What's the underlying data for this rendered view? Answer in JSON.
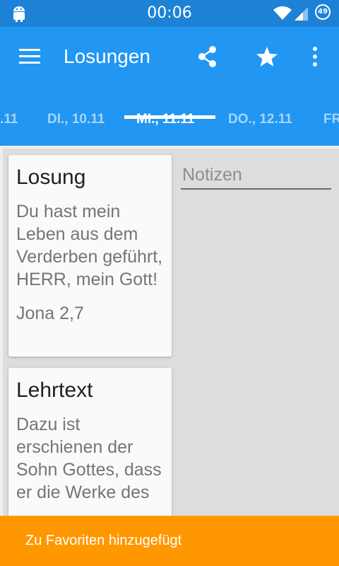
{
  "status_bar": {
    "time": "00:06",
    "battery_level": "49"
  },
  "app_bar": {
    "title": "Losungen",
    "icons": [
      "menu-icon",
      "share-icon",
      "star-icon",
      "more-vert-icon"
    ],
    "background_color": "#2196f3"
  },
  "tabs": [
    {
      "label": ".11"
    },
    {
      "label": "DI., 10.11"
    },
    {
      "label": "MI., 11.11",
      "active": true
    },
    {
      "label": "DO., 12.11"
    },
    {
      "label": "FR"
    }
  ],
  "cards": {
    "losung": {
      "title": "Losung",
      "text": "Du hast mein Leben aus dem Verderben geführt, HERR, mein Gott!",
      "reference": "Jona 2,7"
    },
    "lehrtext": {
      "title": "Lehrtext",
      "text": "Dazu ist erschienen der Sohn Gottes, dass er die Werke des"
    }
  },
  "notes": {
    "placeholder": "Notizen"
  },
  "snackbar": {
    "message": "Zu Favoriten hinzugefügt",
    "background_color": "#ff9800"
  }
}
